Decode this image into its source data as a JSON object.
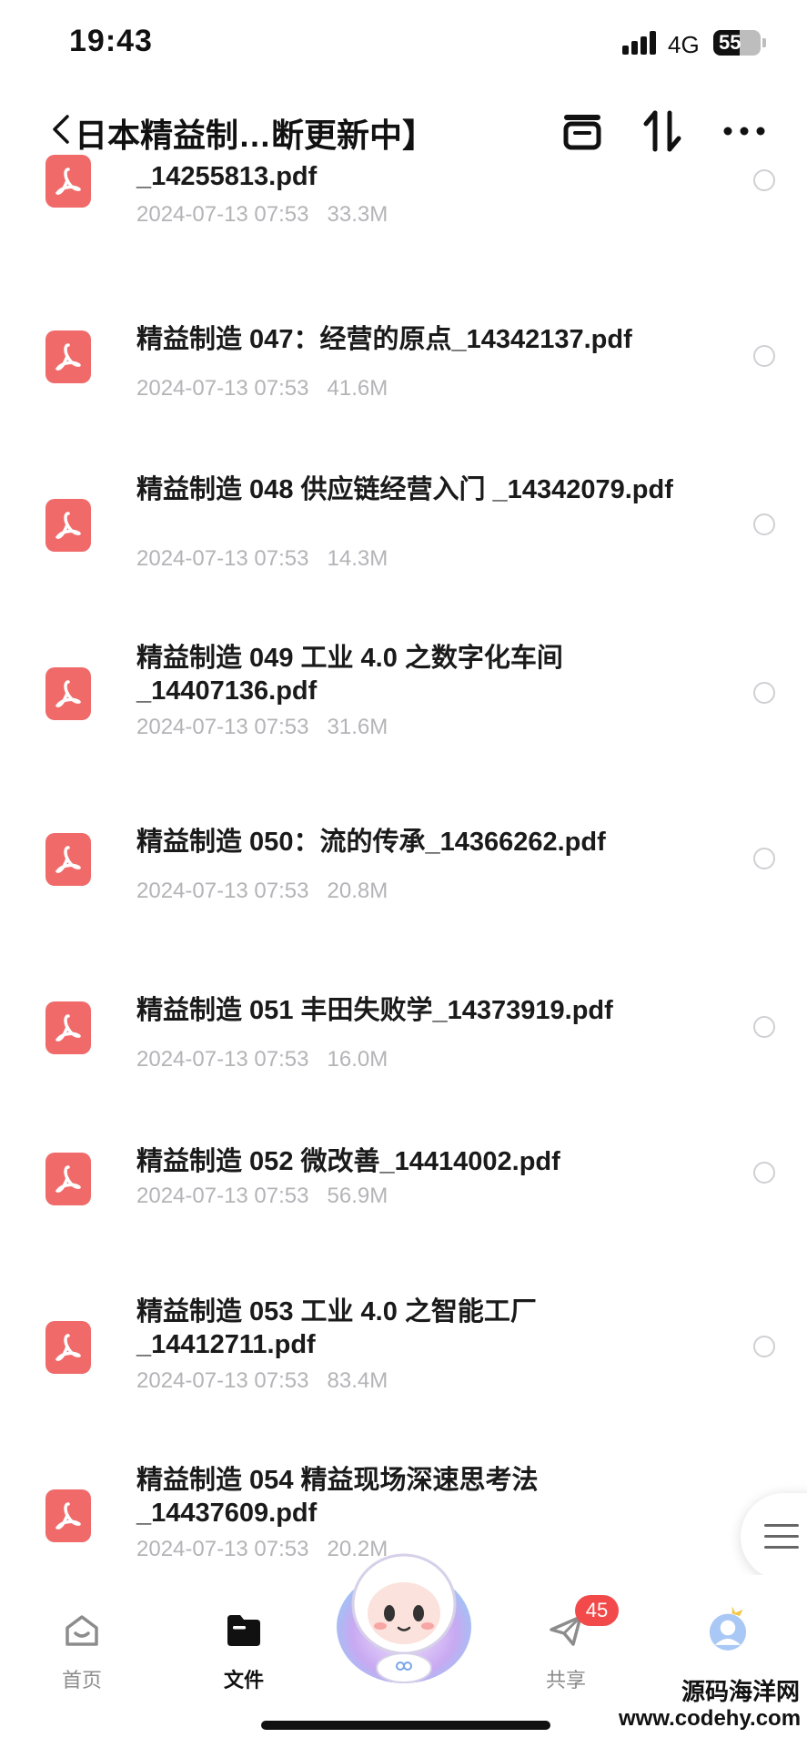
{
  "status_bar": {
    "time": "19:43",
    "network": "4G",
    "battery": "55",
    "battery_level": 0.55
  },
  "nav": {
    "title": "日本精益制…断更新中】",
    "icons": [
      "back-icon",
      "container-icon",
      "sort-icon",
      "more-icon"
    ]
  },
  "files": [
    {
      "name": "_14255813.pdf",
      "date": "2024-07-13 07:53",
      "size": "33.3M"
    },
    {
      "name": "精益制造 047：经营的原点_14342137.pdf",
      "date": "2024-07-13 07:53",
      "size": "41.6M"
    },
    {
      "name": "精益制造 048 供应链经营入门 _14342079.pdf",
      "date": "2024-07-13 07:53",
      "size": "14.3M"
    },
    {
      "name": "精益制造 049 工业 4.0 之数字化车间 _14407136.pdf",
      "date": "2024-07-13 07:53",
      "size": "31.6M"
    },
    {
      "name": "精益制造 050：流的传承_14366262.pdf",
      "date": "2024-07-13 07:53",
      "size": "20.8M"
    },
    {
      "name": "精益制造 051 丰田失败学_14373919.pdf",
      "date": "2024-07-13 07:53",
      "size": "16.0M"
    },
    {
      "name": "精益制造 052 微改善_14414002.pdf",
      "date": "2024-07-13 07:53",
      "size": "56.9M"
    },
    {
      "name": "精益制造 053 工业 4.0 之智能工厂 _14412711.pdf",
      "date": "2024-07-13 07:53",
      "size": "83.4M"
    },
    {
      "name": "精益制造 054 精益现场深速思考法 _14437609.pdf",
      "date": "2024-07-13 07:53",
      "size": "20.2M"
    }
  ],
  "tabs": {
    "home": "首页",
    "files": "文件",
    "share": "共享",
    "share_badge": "45"
  },
  "watermark": {
    "line1": "源码海洋网",
    "line2": "www.codehy.com"
  },
  "colors": {
    "pdf_icon": "#f06a6a",
    "badge": "#f24a4a",
    "meta_text": "#b4b4b8"
  }
}
